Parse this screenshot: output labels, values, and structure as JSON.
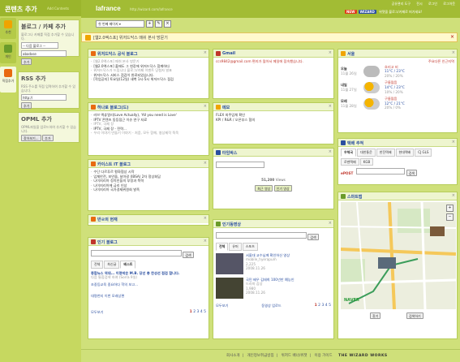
{
  "sidebar": {
    "title": "콘텐츠 추가",
    "subtitle": "Add Contents",
    "tabs": [
      {
        "label": "추천",
        "icon": "star-icon",
        "color": "#f0a400"
      },
      {
        "label": "개인",
        "icon": "user-icon",
        "color": "#6a9b2a"
      },
      {
        "label": "직접추가",
        "icon": "rss-icon",
        "color": "#e86a10"
      }
    ],
    "blog": {
      "title": "블로그 / 카페 추가",
      "desc": "블로그나 카페를 직접 추가할 수 있습니다.",
      "select": "-- 다음 블로그 --",
      "input": "abadxse",
      "btn": "추가"
    },
    "rss": {
      "title": "RSS 추가",
      "desc": "RSS 주소를 직접 입력하여 추가할 수 있습니다.",
      "input": "http://",
      "btn": "추가"
    },
    "opml": {
      "title": "OPML 추가",
      "desc": "OPML파일을 업로드하여 추가할 수 있습니다.",
      "btn1": "찾아보기...",
      "btn2": "추가"
    }
  },
  "topbar": {
    "brand": "lafrance",
    "url": "http://wizard.com/lafrance",
    "links": [
      "공유관리 도구",
      "전시",
      "로그인",
      "로그아웃"
    ],
    "badge1": "NEW",
    "badge2": "WIZARD",
    "badge_text": "위젯을 블로그/카페로 퍼가세요!"
  },
  "page_selector": "첫 번째 페이지",
  "newsbar": {
    "text": "[웹2.0엑스포] 위저드닥스 매쉬 본사 방문기"
  },
  "widgets": {
    "official": {
      "title": "위저드닥스 공식 블로그",
      "items": [
        "[웹2.0엑스포] 매쉬 본사 방문기",
        "[웹2.0엑스포] 출애도 그 현장에 위저드닥스 함께하다",
        "위저드닥스가 드립니다 블로그/카페 이벤트 당첨자 발표",
        "위저드닥스 서비스 점검이 완료되었습니다.",
        "[작업공지] 토요일(12일) 새벽 1시-5시 위저드닥스 점검"
      ]
    },
    "hanaro": {
      "title": "하나로 블로그(드)",
      "items": [
        "러브 엑츄얼리(Love Actually), 'All you need is Love'",
        "IPTV 콘텐츠 동등접근 이슈 연구 자료",
        "IPTV, 국제 장",
        "IPTV, 국제 장 - 전략...",
        "우리 이야기 만들기 이야기 - 처음, 모두 함께, 영상제작 쭉욱"
      ]
    },
    "kaist": {
      "title": "카이스트 IT 블로그",
      "items": [
        "수단 다르푸르 평화협상 시작",
        "입체안전, 보안을, 날아갈 (IBSA) 2차 정상회담",
        "나이지리아 정치인들의 부정과 폭력",
        "나이지리아에 금리 인상",
        "나이지리아 국가경제위원회 발족"
      ]
    },
    "weather_small": {
      "title": "반ㄹ의 현재"
    },
    "gmail": {
      "title": "Gmail",
      "items": [
        "ccs9842@gmail.com 편지가 많아서 메일에 접속했습니다."
      ]
    },
    "memo": {
      "title": "메모",
      "lines": [
        "FLEX 외주업체 확인",
        "KPI / R&R / 오픈부스 협의"
      ]
    },
    "movie": {
      "title": "타임박스",
      "count": "51,200",
      "count_label": "Views",
      "link1": "최근 영상",
      "link2": "인기 영상"
    },
    "weather": {
      "title": "서울",
      "location": "주요다른 인근지역",
      "days": [
        {
          "label": "오늘",
          "date": "11월 26일",
          "desc": "흐리고 비",
          "temp": "11°C / 23°C",
          "rain": "20% / 20%"
        },
        {
          "label": "내일",
          "date": "11월 27일",
          "desc": "구름많음",
          "temp": "14°C / 23°C",
          "rain": "10% / 20%"
        },
        {
          "label": "모레",
          "date": "11월 28일",
          "desc": "구름많음",
          "temp": "12°C / 21°C",
          "rain": "20% / 0%"
        }
      ]
    },
    "delivery": {
      "title": "택배 추적",
      "carriers": [
        "우체국",
        "대한통운",
        "한진택배",
        "현대택배",
        "CJ GLS",
        "로젠택배",
        "KGB"
      ],
      "btn": "검색"
    },
    "map": {
      "title": "스마트맵",
      "btn1": "찾기",
      "btn2": "검색하기",
      "brand": "NAVER"
    },
    "hotblog": {
      "title": "인기 블로그",
      "search_btn": "검색",
      "tabs": [
        "전체",
        "최신글",
        "베스트"
      ],
      "items": [
        "종합뉴스 역대... 이명박은 M.B. 당선 총 찬성선 점검 합니다.",
        "다음 통합검색 하여 (Sorra 9일)",
        "초중등교육 중요하다 학의 보고...",
        "대명천지 이번 모래상편"
      ],
      "pages": [
        "1",
        "2",
        "3",
        "4",
        "5"
      ],
      "more": "모두보기"
    },
    "yahoo": {
      "title": "인기동영상",
      "search_btn": "검색",
      "tabs": [
        "전체",
        "유머",
        "스포츠"
      ],
      "items": [
        {
          "title": "서울대 교수님께 확인하신 영상",
          "user": "mobile_hyerapum",
          "stats": "2,225",
          "date": "2008.11.26"
        },
        {
          "title": "국민 배우 김태희 100년만 예능인",
          "user": "드라마 감상",
          "stats": "1,980",
          "date": "2008.11.26"
        }
      ],
      "pages": [
        "1",
        "2",
        "3",
        "4",
        "5"
      ],
      "more": "모두보기",
      "upload": "동영상 업로드"
    }
  },
  "footer": {
    "links": [
      "회사소개",
      "개인정보취급방침",
      "위저드 배너/위젯",
      "이용 가이드"
    ],
    "brand": "THE WIZARD WORKS"
  }
}
